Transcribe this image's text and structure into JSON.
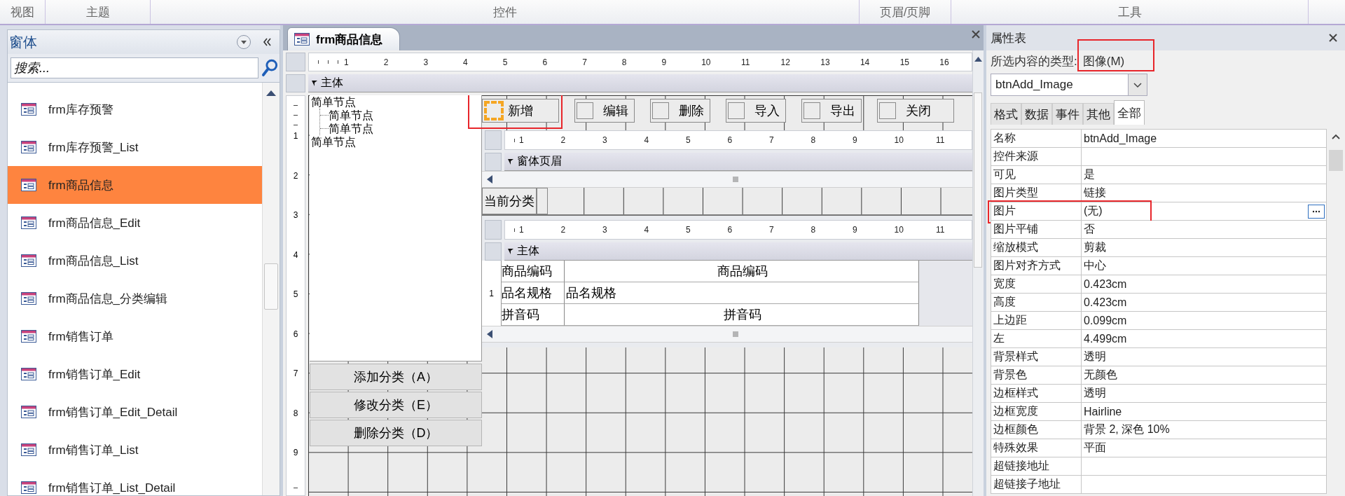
{
  "ribbon_groups": [
    {
      "label": "视图"
    },
    {
      "label": "主题"
    },
    {
      "label": "控件"
    },
    {
      "label": "页眉/页脚"
    },
    {
      "label": "工具"
    }
  ],
  "nav_pane": {
    "title": "窗体",
    "search": {
      "placeholder": "搜索..."
    },
    "items": [
      {
        "label": "frm库存预警",
        "selected": false
      },
      {
        "label": "frm库存预警_List",
        "selected": false
      },
      {
        "label": "frm商品信息",
        "selected": true
      },
      {
        "label": "frm商品信息_Edit",
        "selected": false
      },
      {
        "label": "frm商品信息_List",
        "selected": false
      },
      {
        "label": "frm商品信息_分类编辑",
        "selected": false
      },
      {
        "label": "frm销售订单",
        "selected": false
      },
      {
        "label": "frm销售订单_Edit",
        "selected": false
      },
      {
        "label": "frm销售订单_Edit_Detail",
        "selected": false
      },
      {
        "label": "frm销售订单_List",
        "selected": false
      },
      {
        "label": "frm销售订单_List_Detail",
        "selected": false
      }
    ]
  },
  "document": {
    "tab": {
      "title": "frm商品信息"
    },
    "ruler": [
      "1",
      "2",
      "3",
      "4",
      "5",
      "6",
      "7",
      "8",
      "9",
      "10",
      "11",
      "12",
      "13",
      "14",
      "15",
      "16"
    ],
    "side_ruler": [
      "1",
      "2",
      "3",
      "4",
      "5",
      "6",
      "7",
      "8",
      "9"
    ],
    "section": "主体",
    "tree": [
      {
        "label": "简单节点",
        "children": [
          {
            "label": "简单节点"
          },
          {
            "label": "简单节点"
          }
        ]
      },
      {
        "label": "简单节点"
      }
    ],
    "toolbar_buttons": [
      {
        "label": "新增",
        "image_selected": true,
        "highlighted": true
      },
      {
        "label": "编辑",
        "image_selected": false,
        "highlighted": false
      },
      {
        "label": "删除",
        "image_selected": false,
        "highlighted": false
      },
      {
        "label": "导入",
        "image_selected": false,
        "highlighted": false
      },
      {
        "label": "导出",
        "image_selected": false,
        "highlighted": false
      },
      {
        "label": "关闭",
        "image_selected": false,
        "highlighted": false
      }
    ],
    "category_buttons": [
      {
        "label": "添加分类（A）"
      },
      {
        "label": "修改分类（E）"
      },
      {
        "label": "删除分类（D）"
      }
    ],
    "subform": {
      "ruler": [
        "1",
        "2",
        "3",
        "4",
        "5",
        "6",
        "7",
        "8",
        "9",
        "10",
        "11"
      ],
      "header_section": "窗体页眉",
      "header_label": "当前分类",
      "ruler_2": [
        "1",
        "2",
        "3",
        "4",
        "5",
        "6",
        "7",
        "8",
        "9",
        "10",
        "11"
      ],
      "body_section": "主体",
      "side_ruler": [
        "1"
      ],
      "fields": [
        {
          "label": "商品编码",
          "value": "商品编码",
          "kind": "centered"
        },
        {
          "label": "品名规格",
          "value": "品名规格",
          "kind": "plain"
        },
        {
          "label": "拼音码",
          "value": "拼音码",
          "kind": "centered"
        }
      ]
    }
  },
  "property_sheet": {
    "title": "属性表",
    "selection_label": "所选内容的类型:",
    "selection_type": {
      "text": "图像(M)",
      "highlighted": true
    },
    "object_selector": "btnAdd_Image",
    "tabs": [
      {
        "label": "格式",
        "selected": false
      },
      {
        "label": "数据",
        "selected": false
      },
      {
        "label": "事件",
        "selected": false
      },
      {
        "label": "其他",
        "selected": false
      },
      {
        "label": "全部",
        "selected": true
      }
    ],
    "rows": [
      {
        "name": "名称",
        "value": "btnAdd_Image",
        "builder": false,
        "highlighted": false
      },
      {
        "name": "控件来源",
        "builder": false,
        "highlighted": false
      },
      {
        "name": "可见",
        "value": "是",
        "builder": false,
        "highlighted": false
      },
      {
        "name": "图片类型",
        "value": "链接",
        "builder": false,
        "highlighted": false
      },
      {
        "name": "图片",
        "value": "(无)",
        "builder": true,
        "highlighted": true
      },
      {
        "name": "图片平铺",
        "value": "否",
        "builder": false,
        "highlighted": false
      },
      {
        "name": "缩放模式",
        "value": "剪裁",
        "builder": false,
        "highlighted": false
      },
      {
        "name": "图片对齐方式",
        "value": "中心",
        "builder": false,
        "highlighted": false
      },
      {
        "name": "宽度",
        "value": "0.423cm",
        "builder": false,
        "highlighted": false
      },
      {
        "name": "高度",
        "value": "0.423cm",
        "builder": false,
        "highlighted": false
      },
      {
        "name": "上边距",
        "value": "0.099cm",
        "builder": false,
        "highlighted": false
      },
      {
        "name": "左",
        "value": "4.499cm",
        "builder": false,
        "highlighted": false
      },
      {
        "name": "背景样式",
        "value": "透明",
        "builder": false,
        "highlighted": false
      },
      {
        "name": "背景色",
        "value": "无颜色",
        "builder": false,
        "highlighted": false
      },
      {
        "name": "边框样式",
        "value": "透明",
        "builder": false,
        "highlighted": false
      },
      {
        "name": "边框宽度",
        "value": "Hairline",
        "builder": false,
        "highlighted": false
      },
      {
        "name": "边框颜色",
        "value": "背景 2, 深色 10%",
        "builder": false,
        "highlighted": false
      },
      {
        "name": "特殊效果",
        "value": "平面",
        "builder": false,
        "highlighted": false
      },
      {
        "name": "超链接地址",
        "builder": false,
        "highlighted": false
      },
      {
        "name": "超链接子地址",
        "builder": false,
        "highlighted": false
      }
    ]
  }
}
